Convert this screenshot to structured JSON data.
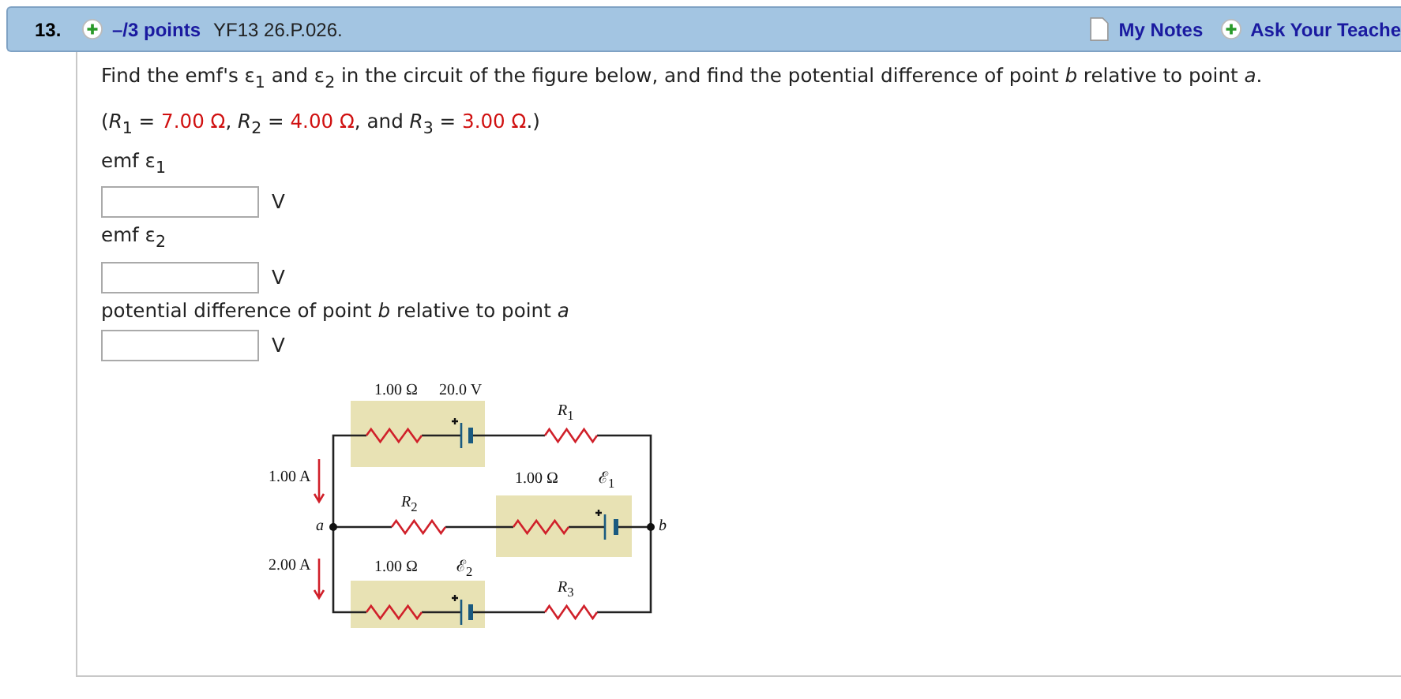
{
  "header": {
    "number": "13.",
    "points": "–/3 points",
    "code": "YF13 26.P.026.",
    "links": [
      {
        "label": "My Notes",
        "kind": "notes"
      },
      {
        "label": "Ask Your Teache",
        "kind": "ask"
      }
    ]
  },
  "question": {
    "prompt": "Find the emf's ε$_{1}$ and ε$_{2}$ in the circuit of the figure below, and find the potential difference of point *b* relative to point *a*.",
    "givens": [
      {
        "text": "(*R*$_{1}$ = ",
        "highlight": false
      },
      {
        "text": "7.00 Ω",
        "highlight": true
      },
      {
        "text": ", *R*$_{2}$ = ",
        "highlight": false
      },
      {
        "text": "4.00 Ω",
        "highlight": true
      },
      {
        "text": ", and *R*$_{3}$ = ",
        "highlight": false
      },
      {
        "text": "3.00 Ω",
        "highlight": true
      },
      {
        "text": ".)",
        "highlight": false
      }
    ]
  },
  "answers": [
    {
      "label": "emf ε$_{1}$",
      "unit": "V"
    },
    {
      "label": "emf ε$_{2}$",
      "unit": "V"
    },
    {
      "label": "potential difference of point *b* relative to point *a*",
      "unit": "V"
    }
  ],
  "figure_labels": [
    "1.00 Ω",
    "20.0 V",
    "*R*$_{1}$",
    "1.00 A",
    "1.00 Ω",
    "ℰ$_{1}$",
    "*R*$_{2}$",
    "*a*",
    "*b*",
    "2.00 A",
    "1.00 Ω",
    "ℰ$_{2}$",
    "*R*$_{3}$"
  ]
}
